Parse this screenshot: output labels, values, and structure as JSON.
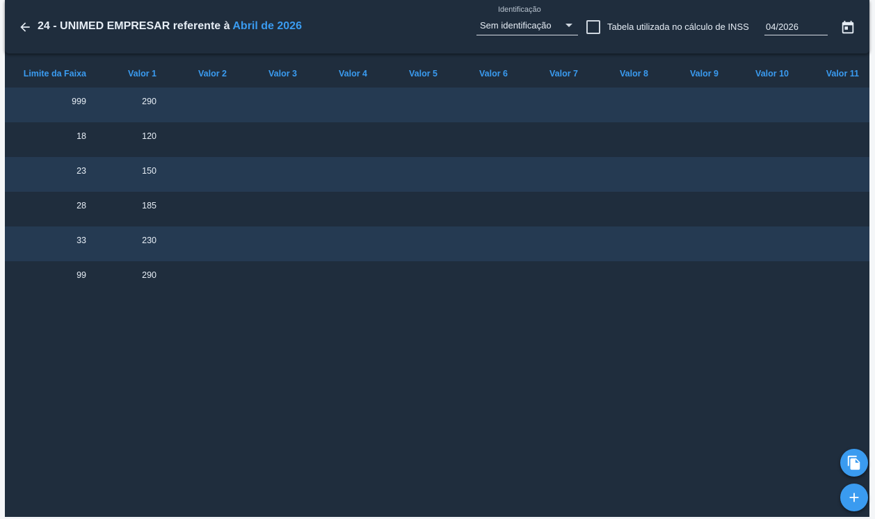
{
  "header": {
    "title_prefix": "24 - UNIMED EMPRESAR referente à",
    "title_highlight": "Abril de 2026",
    "identification_label": "Identificação",
    "identification_value": "Sem identificação",
    "inss_checkbox_label": "Tabela utilizada no cálculo de INSS",
    "inss_checked": false,
    "date_value": "04/2026"
  },
  "table": {
    "columns": [
      "Limite da Faixa",
      "Valor 1",
      "Valor 2",
      "Valor 3",
      "Valor 4",
      "Valor 5",
      "Valor 6",
      "Valor 7",
      "Valor 8",
      "Valor 9",
      "Valor 10",
      "Valor 11"
    ],
    "rows": [
      {
        "limite": "999",
        "valor1": "290"
      },
      {
        "limite": "18",
        "valor1": "120"
      },
      {
        "limite": "23",
        "valor1": "150"
      },
      {
        "limite": "28",
        "valor1": "185"
      },
      {
        "limite": "33",
        "valor1": "230"
      },
      {
        "limite": "99",
        "valor1": "290"
      }
    ]
  },
  "icons": {
    "back": "arrow-left-icon",
    "calendar": "calendar-icon",
    "copy": "copy-icon",
    "add": "plus-icon"
  },
  "colors": {
    "accent": "#3a9bf0",
    "background": "#1f2d3d",
    "row_alt": "#253a52"
  }
}
